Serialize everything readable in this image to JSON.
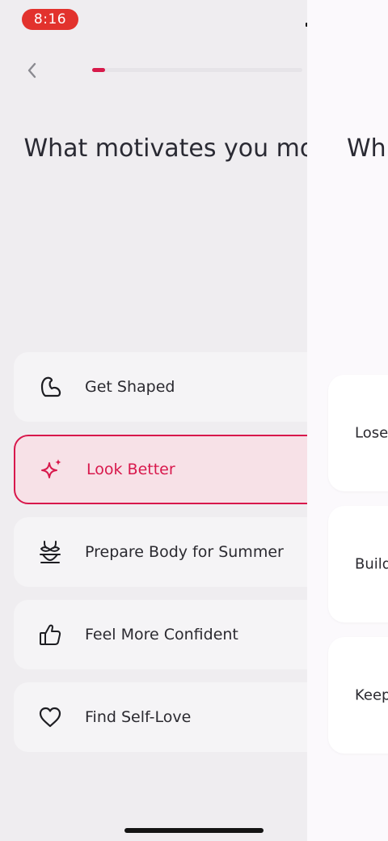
{
  "status_bar": {
    "time": "8:16"
  },
  "left_page": {
    "progress": 0.06,
    "question": "What motivates you most?",
    "options": [
      {
        "label": "Get Shaped",
        "icon": "flexed-bicep-icon",
        "selected": false
      },
      {
        "label": "Look Better",
        "icon": "sparkle-icon",
        "selected": true
      },
      {
        "label": "Prepare Body for Summer",
        "icon": "bikini-icon",
        "selected": false
      },
      {
        "label": "Feel More Confident",
        "icon": "thumbs-up-icon",
        "selected": false
      },
      {
        "label": "Find Self-Love",
        "icon": "heart-icon",
        "selected": false
      }
    ]
  },
  "right_page": {
    "question_partial": "Wh",
    "options_partial": [
      "Lose",
      "Build",
      "Keep"
    ]
  },
  "colors": {
    "accent": "#d8184c",
    "time_pill": "#e2322d",
    "battery": "#f2c21b"
  }
}
